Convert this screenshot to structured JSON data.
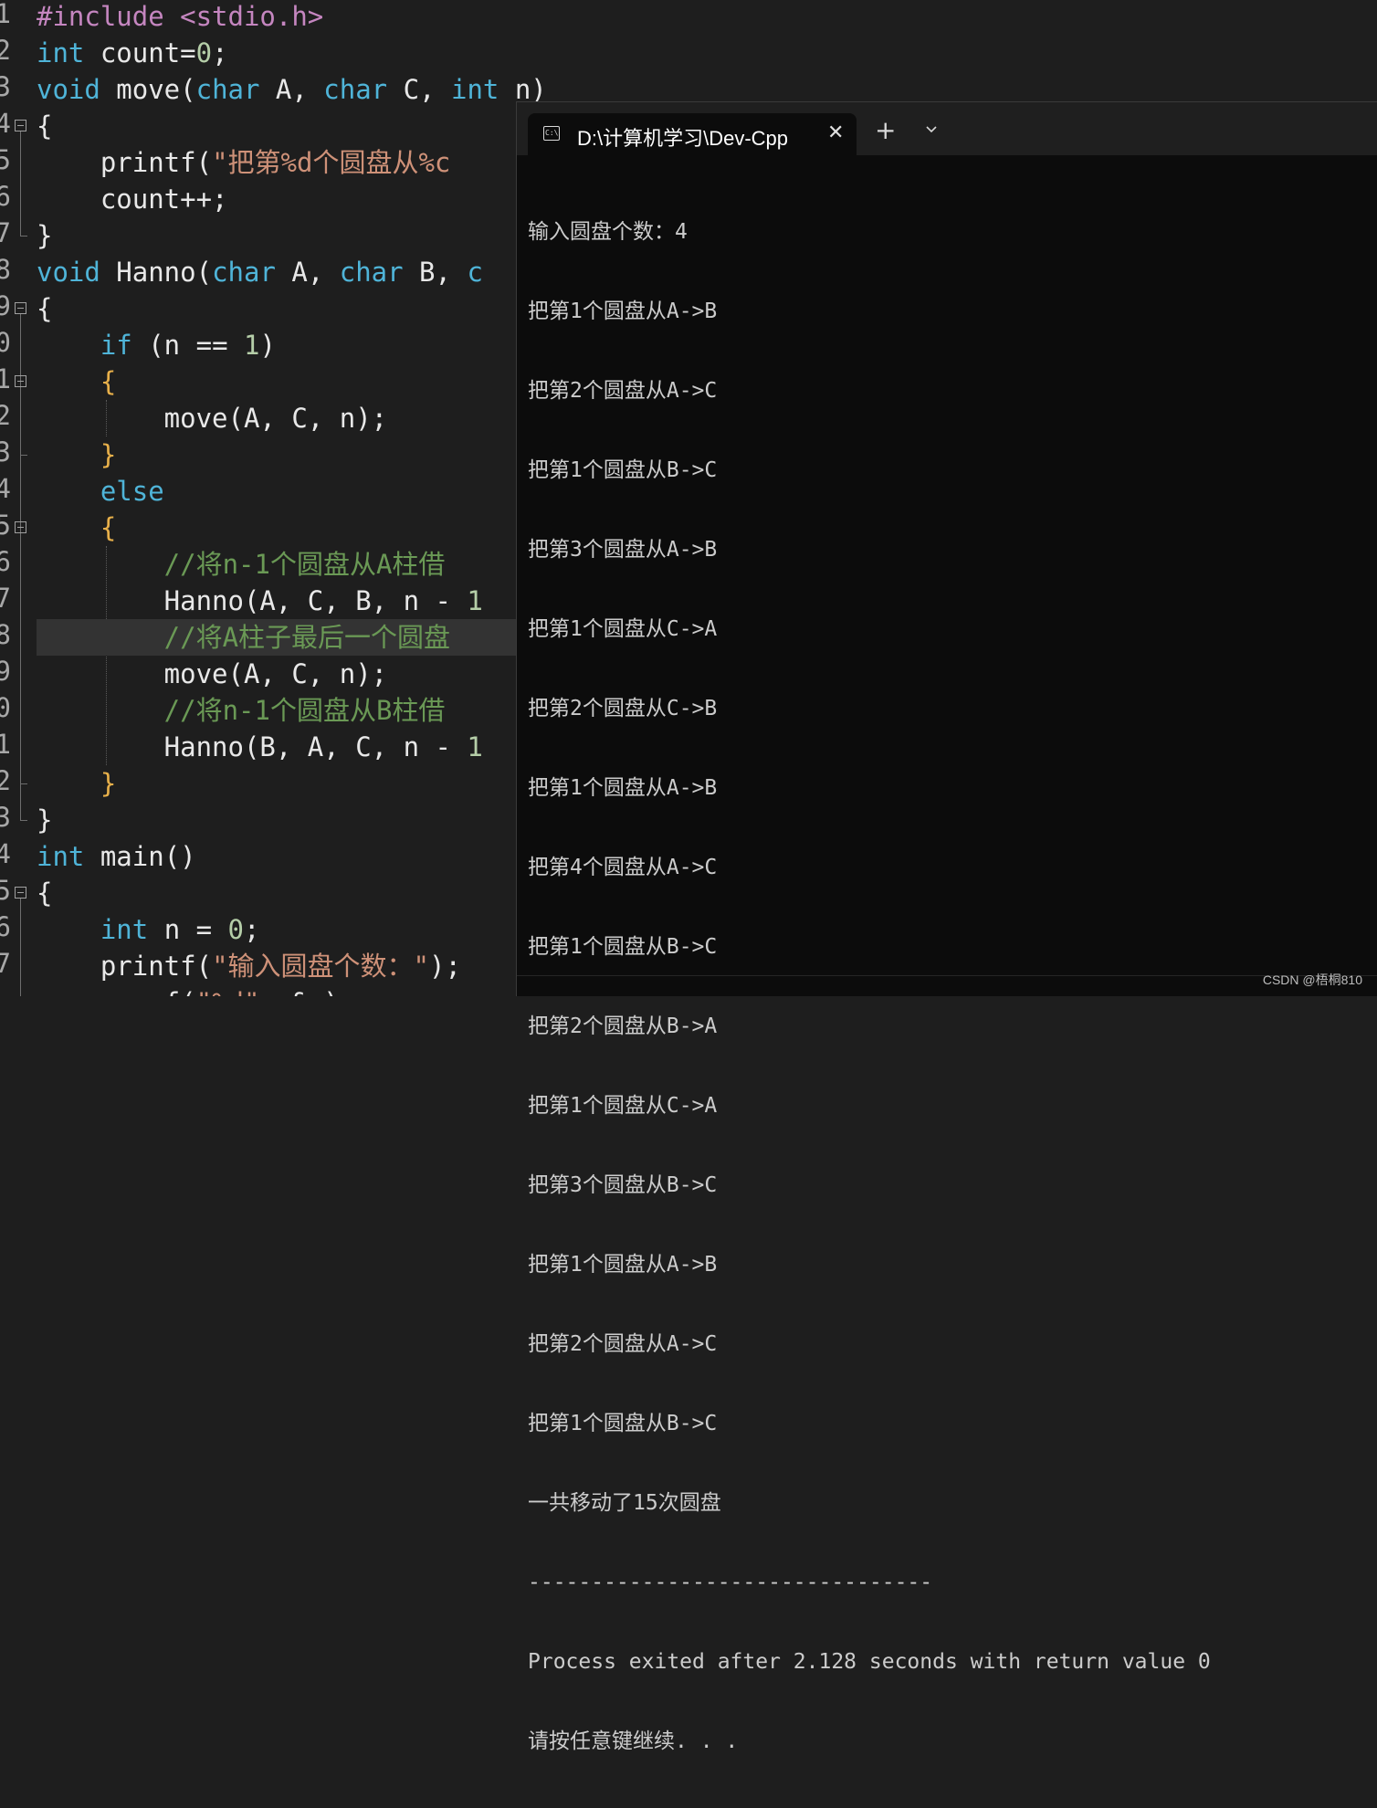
{
  "editor": {
    "line_numbers": [
      "1",
      "2",
      "3",
      "4",
      "5",
      "6",
      "7",
      "8",
      "9",
      "0",
      "1",
      "2",
      "3",
      "4",
      "5",
      "6",
      "7",
      "8",
      "9",
      "0",
      "1",
      "2",
      "3",
      "4",
      "5",
      "6",
      "7"
    ],
    "lines": [
      "#include <stdio.h>",
      "int count=0;",
      "void move(char A, char C, int n)",
      "{",
      "    printf(\"把第%d个圆盘从%c",
      "    count++;",
      "}",
      "void Hanno(char A, char B, c",
      "{",
      "    if (n == 1)",
      "    {",
      "        move(A, C, n);",
      "    }",
      "    else",
      "    {",
      "        //将n-1个圆盘从A柱借",
      "        Hanno(A, C, B, n - 1",
      "        //将A柱子最后一个圆盘",
      "        move(A, C, n);",
      "        //将n-1个圆盘从B柱借",
      "        Hanno(B, A, C, n - 1",
      "    }",
      "}",
      "int main()",
      "{",
      "    int n = 0;",
      "    printf(\"输入圆盘个数：\");",
      "    scanf(\"%d\", &n);"
    ]
  },
  "console": {
    "tab_title": "D:\\计算机学习\\Dev-Cpp",
    "tab_icon": "terminal-icon",
    "close_glyph": "✕",
    "new_tab_glyph": "+",
    "output": [
      "输入圆盘个数：4",
      "把第1个圆盘从A->B",
      "把第2个圆盘从A->C",
      "把第1个圆盘从B->C",
      "把第3个圆盘从A->B",
      "把第1个圆盘从C->A",
      "把第2个圆盘从C->B",
      "把第1个圆盘从A->B",
      "把第4个圆盘从A->C",
      "把第1个圆盘从B->C",
      "把第2个圆盘从B->A",
      "把第1个圆盘从C->A",
      "把第3个圆盘从B->C",
      "把第1个圆盘从A->B",
      "把第2个圆盘从A->C",
      "把第1个圆盘从B->C",
      "一共移动了15次圆盘",
      "--------------------------------",
      "Process exited after 2.128 seconds with return value 0",
      "请按任意键继续. . ."
    ]
  },
  "watermark": "CSDN @梧桐810"
}
